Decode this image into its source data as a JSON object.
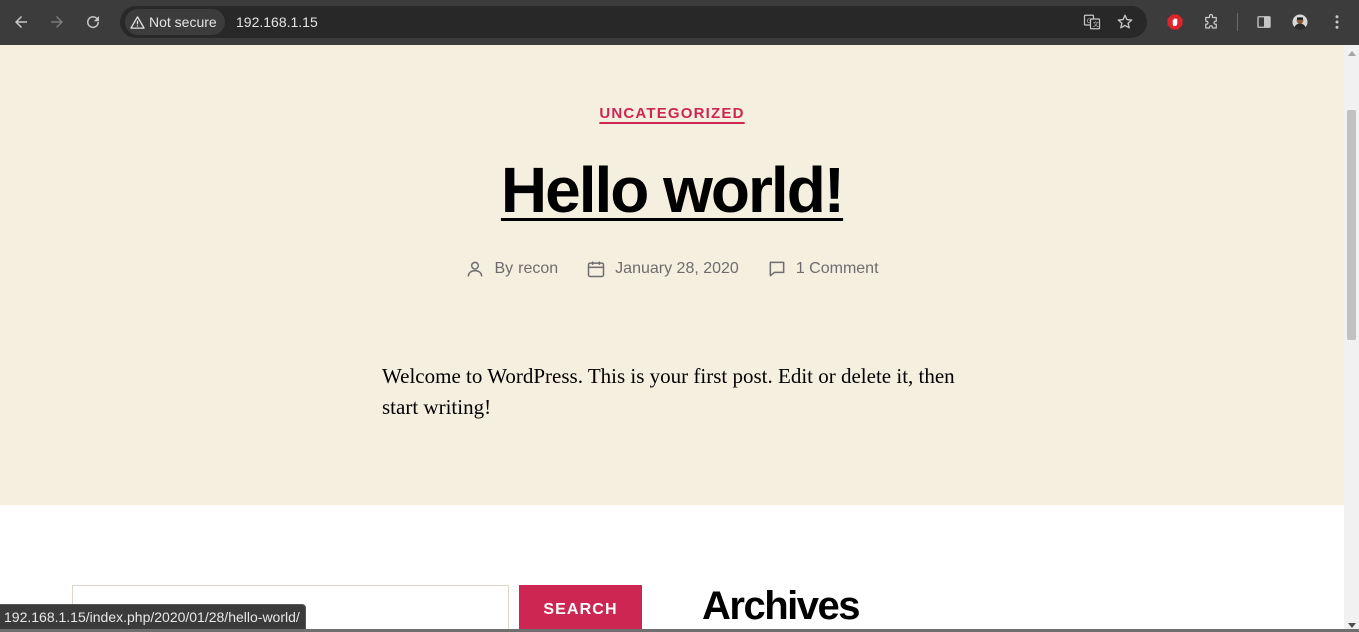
{
  "browser": {
    "security_label": "Not secure",
    "url": "192.168.1.15",
    "status_url": "192.168.1.15/index.php/2020/01/28/hello-world/",
    "icons": [
      "back-icon",
      "forward-icon",
      "reload-icon",
      "warning-icon",
      "translate-icon",
      "star-icon",
      "adblock-icon",
      "extensions-icon",
      "side-panel-icon",
      "profile-avatar",
      "menu-icon"
    ]
  },
  "post": {
    "category": "UNCATEGORIZED",
    "title": "Hello world!",
    "author_prefix": "By",
    "author": "recon",
    "date": "January 28, 2020",
    "comments": "1 Comment",
    "body": "Welcome to WordPress. This is your first post. Edit or delete it, then start writing!"
  },
  "widgets": {
    "search_button": "SEARCH",
    "search_placeholder": "",
    "archives_title": "Archives"
  },
  "colors": {
    "accent": "#cd2653",
    "hero_bg": "#f5efe0",
    "meta_text": "#6d6d6d"
  }
}
